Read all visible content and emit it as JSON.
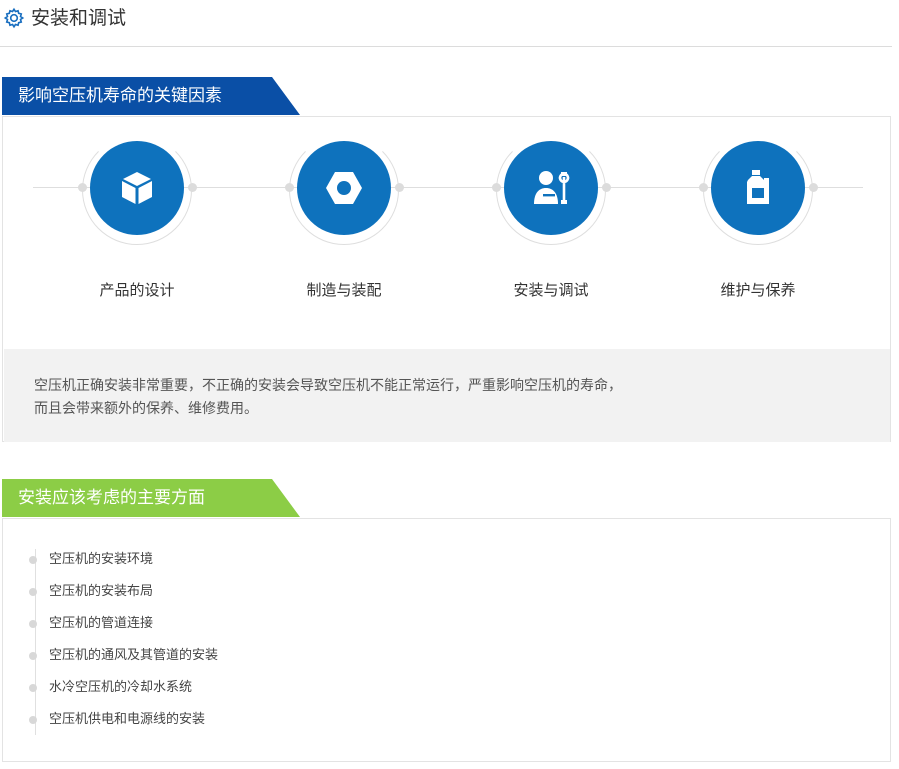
{
  "header": {
    "title": "安装和调试",
    "icon": "gear-icon",
    "icon_color": "#1a6fc0"
  },
  "factors_section": {
    "title": "影响空压机寿命的关键因素",
    "accent": "#0a4fa6",
    "items": [
      {
        "label": "产品的设计",
        "icon": "cube-icon"
      },
      {
        "label": "制造与装配",
        "icon": "hex-nut-icon"
      },
      {
        "label": "安装与调试",
        "icon": "worker-wrench-icon"
      },
      {
        "label": "维护与保养",
        "icon": "oil-bottle-icon"
      }
    ],
    "circle_color": "#0e72bd",
    "description_line1": "空压机正确安装非常重要，不正确的安装会导致空压机不能正常运行，严重影响空压机的寿命，",
    "description_line2": "而且会带来额外的保养、维修费用。"
  },
  "aspects_section": {
    "title": "安装应该考虑的主要方面",
    "accent": "#8ccd46",
    "items": [
      "空压机的安装环境",
      "空压机的安装布局",
      "空压机的管道连接",
      "空压机的通风及其管道的安装",
      "水冷空压机的冷却水系统",
      "空压机供电和电源线的安装"
    ]
  }
}
